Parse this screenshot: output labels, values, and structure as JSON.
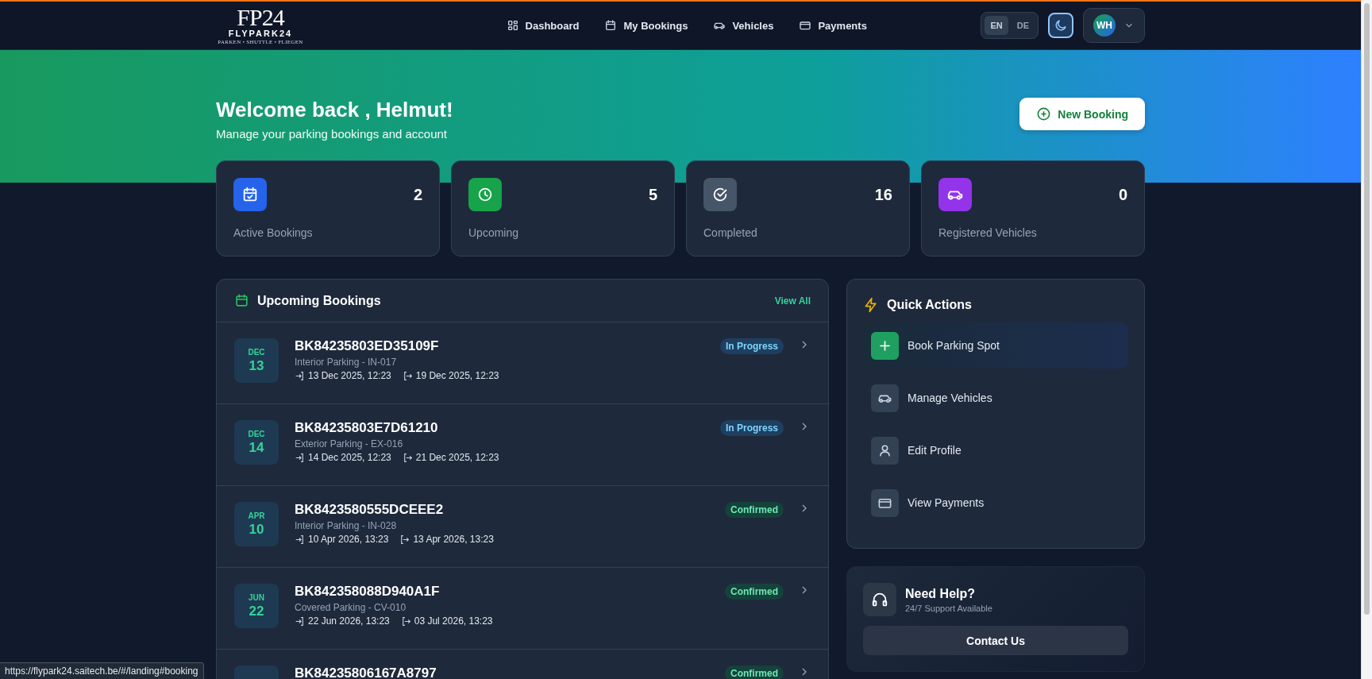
{
  "header": {
    "logo": {
      "mark": "FP24",
      "name": "FLYPARK24",
      "tagline": "PARKEN • SHUTTLE • FLIEGEN"
    },
    "nav": [
      {
        "label": "Dashboard"
      },
      {
        "label": "My Bookings"
      },
      {
        "label": "Vehicles"
      },
      {
        "label": "Payments"
      }
    ],
    "languages": [
      {
        "label": "EN",
        "selected": true
      },
      {
        "label": "DE",
        "selected": false
      }
    ],
    "user": {
      "initials": "WH"
    }
  },
  "hero": {
    "title": "Welcome back , Helmut!",
    "subtitle": "Manage your parking bookings and account",
    "button": "New Booking"
  },
  "stats": [
    {
      "value": "2",
      "label": "Active Bookings",
      "color": "#2563eb"
    },
    {
      "value": "5",
      "label": "Upcoming",
      "color": "#16a34a"
    },
    {
      "value": "16",
      "label": "Completed",
      "color": "#475569"
    },
    {
      "value": "0",
      "label": "Registered Vehicles",
      "color": "#9333ea"
    }
  ],
  "upcoming": {
    "title": "Upcoming Bookings",
    "link": "View All",
    "rows": [
      {
        "month": "DEC",
        "day": "13",
        "id": "BK84235803ED35109F",
        "location": "Interior Parking - IN-017",
        "start": "13 Dec 2025, 12:23",
        "end": "19 Dec 2025, 12:23",
        "status": "In Progress",
        "kind": "in_progress"
      },
      {
        "month": "DEC",
        "day": "14",
        "id": "BK84235803E7D61210",
        "location": "Exterior Parking - EX-016",
        "start": "14 Dec 2025, 12:23",
        "end": "21 Dec 2025, 12:23",
        "status": "In Progress",
        "kind": "in_progress"
      },
      {
        "month": "APR",
        "day": "10",
        "id": "BK8423580555DCEEE2",
        "location": "Interior Parking - IN-028",
        "start": "10 Apr 2026, 13:23",
        "end": "13 Apr 2026, 13:23",
        "status": "Confirmed",
        "kind": "confirmed"
      },
      {
        "month": "JUN",
        "day": "22",
        "id": "BK842358088D940A1F",
        "location": "Covered Parking - CV-010",
        "start": "22 Jun 2026, 13:23",
        "end": "03 Jul 2026, 13:23",
        "status": "Confirmed",
        "kind": "confirmed"
      },
      {
        "id": "BK84235806167A8797",
        "status": "Confirmed",
        "kind": "confirmed"
      }
    ]
  },
  "quick_actions": {
    "title": "Quick Actions",
    "items": [
      {
        "label": "Book Parking Spot",
        "selected": true
      },
      {
        "label": "Manage Vehicles",
        "selected": false
      },
      {
        "label": "Edit Profile",
        "selected": false
      },
      {
        "label": "View Payments",
        "selected": false
      }
    ]
  },
  "help": {
    "title": "Need Help?",
    "subtitle": "24/7 Support Available",
    "button": "Contact Us"
  },
  "status_bar": {
    "url": "https://flypark24.saitech.be/#/landing#booking"
  }
}
